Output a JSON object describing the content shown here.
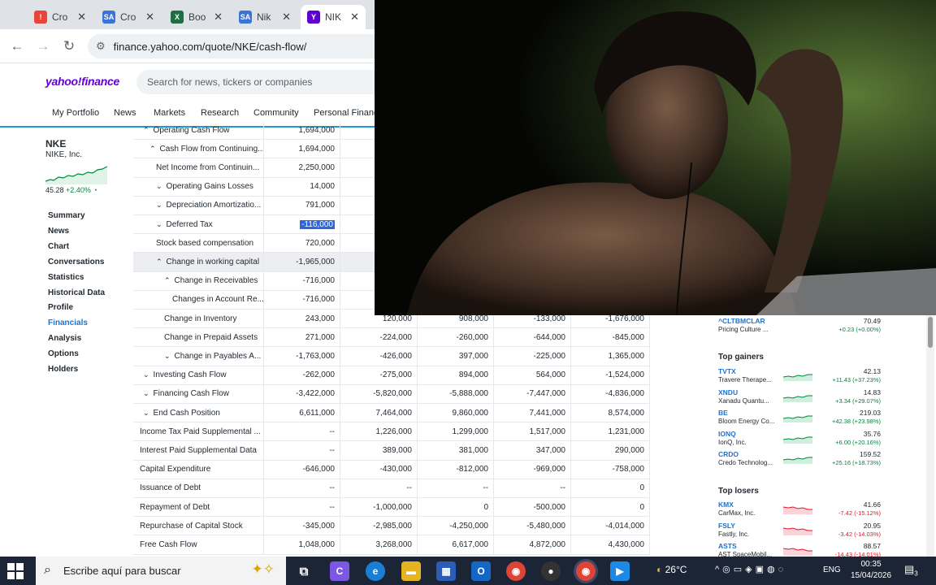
{
  "browser": {
    "tabs": [
      {
        "label": "Cro",
        "icon": "crowdstrike-icon",
        "color": "#e8443a"
      },
      {
        "label": "Cro",
        "icon": "seeking-alpha-icon",
        "color": "#3a74d8"
      },
      {
        "label": "Boo",
        "icon": "excel-icon",
        "color": "#1d7044"
      },
      {
        "label": "Nik",
        "icon": "seeking-alpha-icon",
        "color": "#3a74d8"
      },
      {
        "label": "NIK",
        "icon": "yahoo-icon",
        "color": "#6001d2"
      }
    ],
    "url": "finance.yahoo.com/quote/NKE/cash-flow/"
  },
  "yahoo": {
    "logo": "yahoo!finance",
    "search_placeholder": "Search for news, tickers or companies",
    "nav": [
      "My Portfolio",
      "News",
      "Markets",
      "Research",
      "Community",
      "Personal Finance"
    ]
  },
  "quote": {
    "ticker": "NKE",
    "company": "NIKE, Inc.",
    "price": "45.28",
    "change": "+2.40%"
  },
  "sidebar_links": [
    "Summary",
    "News",
    "Chart",
    "Conversations",
    "Statistics",
    "Historical Data",
    "Profile",
    "Financials",
    "Analysis",
    "Options",
    "Holders"
  ],
  "table": {
    "rows": [
      {
        "label": "Operating Cash Flow",
        "indent": 1,
        "chev": "up",
        "values": [
          "1,694,000",
          "",
          "",
          "",
          ""
        ]
      },
      {
        "label": "Cash Flow from Continuing...",
        "indent": 2,
        "chev": "up",
        "values": [
          "1,694,000",
          "",
          "",
          "",
          ""
        ]
      },
      {
        "label": "Net Income from Continuin...",
        "indent": 3,
        "chev": "",
        "values": [
          "2,250,000",
          "",
          "",
          "",
          ""
        ]
      },
      {
        "label": "Operating Gains Losses",
        "indent": 3,
        "chev": "down",
        "values": [
          "14,000",
          "",
          "",
          "",
          ""
        ]
      },
      {
        "label": "Depreciation Amortizatio...",
        "indent": 3,
        "chev": "down",
        "values": [
          "791,000",
          "",
          "",
          "",
          ""
        ]
      },
      {
        "label": "Deferred Tax",
        "indent": 3,
        "chev": "down",
        "values": [
          "-116,000",
          "",
          "",
          "",
          ""
        ],
        "selected": true
      },
      {
        "label": "Stock based compensation",
        "indent": 3,
        "chev": "",
        "values": [
          "720,000",
          "",
          "",
          "",
          ""
        ]
      },
      {
        "label": "Change in working capital",
        "indent": 3,
        "chev": "up",
        "values": [
          "-1,965,000",
          "",
          "",
          "",
          ""
        ],
        "highlight": true
      },
      {
        "label": "Change in Receivables",
        "indent": 4,
        "chev": "up",
        "values": [
          "-716,000",
          "",
          "",
          "",
          ""
        ]
      },
      {
        "label": "Changes in Account Re...",
        "indent": 5,
        "chev": "",
        "values": [
          "-716,000",
          "",
          "",
          "",
          ""
        ]
      },
      {
        "label": "Change in Inventory",
        "indent": 4,
        "chev": "",
        "values": [
          "243,000",
          "120,000",
          "908,000",
          "-133,000",
          "-1,676,000"
        ]
      },
      {
        "label": "Change in Prepaid Assets",
        "indent": 4,
        "chev": "",
        "values": [
          "271,000",
          "-224,000",
          "-260,000",
          "-644,000",
          "-845,000"
        ]
      },
      {
        "label": "Change in Payables A...",
        "indent": 4,
        "chev": "down",
        "values": [
          "-1,763,000",
          "-426,000",
          "397,000",
          "-225,000",
          "1,365,000"
        ]
      },
      {
        "label": "Investing Cash Flow",
        "indent": 1,
        "chev": "down",
        "values": [
          "-262,000",
          "-275,000",
          "894,000",
          "564,000",
          "-1,524,000"
        ]
      },
      {
        "label": "Financing Cash Flow",
        "indent": 1,
        "chev": "down",
        "values": [
          "-3,422,000",
          "-5,820,000",
          "-5,888,000",
          "-7,447,000",
          "-4,836,000"
        ]
      },
      {
        "label": "End Cash Position",
        "indent": 1,
        "chev": "down",
        "values": [
          "6,611,000",
          "7,464,000",
          "9,860,000",
          "7,441,000",
          "8,574,000"
        ]
      },
      {
        "label": "Income Tax Paid Supplemental ...",
        "indent": 0,
        "chev": "",
        "values": [
          "--",
          "1,226,000",
          "1,299,000",
          "1,517,000",
          "1,231,000"
        ]
      },
      {
        "label": "Interest Paid Supplemental Data",
        "indent": 0,
        "chev": "",
        "values": [
          "--",
          "389,000",
          "381,000",
          "347,000",
          "290,000"
        ]
      },
      {
        "label": "Capital Expenditure",
        "indent": 0,
        "chev": "",
        "values": [
          "-646,000",
          "-430,000",
          "-812,000",
          "-969,000",
          "-758,000"
        ]
      },
      {
        "label": "Issuance of Debt",
        "indent": 0,
        "chev": "",
        "values": [
          "--",
          "--",
          "--",
          "--",
          "0"
        ]
      },
      {
        "label": "Repayment of Debt",
        "indent": 0,
        "chev": "",
        "values": [
          "--",
          "-1,000,000",
          "0",
          "-500,000",
          "0"
        ]
      },
      {
        "label": "Repurchase of Capital Stock",
        "indent": 0,
        "chev": "",
        "values": [
          "-345,000",
          "-2,985,000",
          "-4,250,000",
          "-5,480,000",
          "-4,014,000"
        ]
      },
      {
        "label": "Free Cash Flow",
        "indent": 0,
        "chev": "",
        "values": [
          "1,048,000",
          "3,268,000",
          "6,617,000",
          "4,872,000",
          "4,430,000"
        ]
      }
    ]
  },
  "right": {
    "top_item": {
      "symbol": "^CLTBMCLAR",
      "name": "Pricing Culture ...",
      "price": "70.49",
      "change": "+0.23 (+0.00%)"
    },
    "gainers_title": "Top gainers",
    "gainers": [
      {
        "symbol": "TVTX",
        "name": "Travere Therape...",
        "price": "42.13",
        "change": "+11.43 (+37.23%)"
      },
      {
        "symbol": "XNDU",
        "name": "Xanadu Quantu...",
        "price": "14.83",
        "change": "+3.34 (+29.07%)"
      },
      {
        "symbol": "BE",
        "name": "Bloom Energy Co...",
        "price": "219.03",
        "change": "+42.38 (+23.98%)"
      },
      {
        "symbol": "IONQ",
        "name": "IonQ, Inc.",
        "price": "35.76",
        "change": "+6.00 (+20.16%)"
      },
      {
        "symbol": "CRDO",
        "name": "Credo Technolog...",
        "price": "159.52",
        "change": "+25.16 (+18.73%)"
      }
    ],
    "losers_title": "Top losers",
    "losers": [
      {
        "symbol": "KMX",
        "name": "CarMax, Inc.",
        "price": "41.66",
        "change": "-7.42 (-15.12%)"
      },
      {
        "symbol": "FSLY",
        "name": "Fastly, Inc.",
        "price": "20.95",
        "change": "-3.42 (-14.03%)"
      },
      {
        "symbol": "ASTS",
        "name": "AST SpaceMobil...",
        "price": "88.57",
        "change": "-14.43 (-14.01%)"
      }
    ]
  },
  "taskbar": {
    "search_placeholder": "Escribe aquí para buscar",
    "temperature": "26°C",
    "language": "ENG",
    "time": "00:35",
    "date": "15/04/2026",
    "notifications": "3"
  },
  "colors": {
    "yahoo_purple": "#6001d2",
    "link_blue": "#1d72d2",
    "gain_green": "#00873c",
    "loss_red": "#eb0f29",
    "selection_blue": "#2f66d8"
  }
}
